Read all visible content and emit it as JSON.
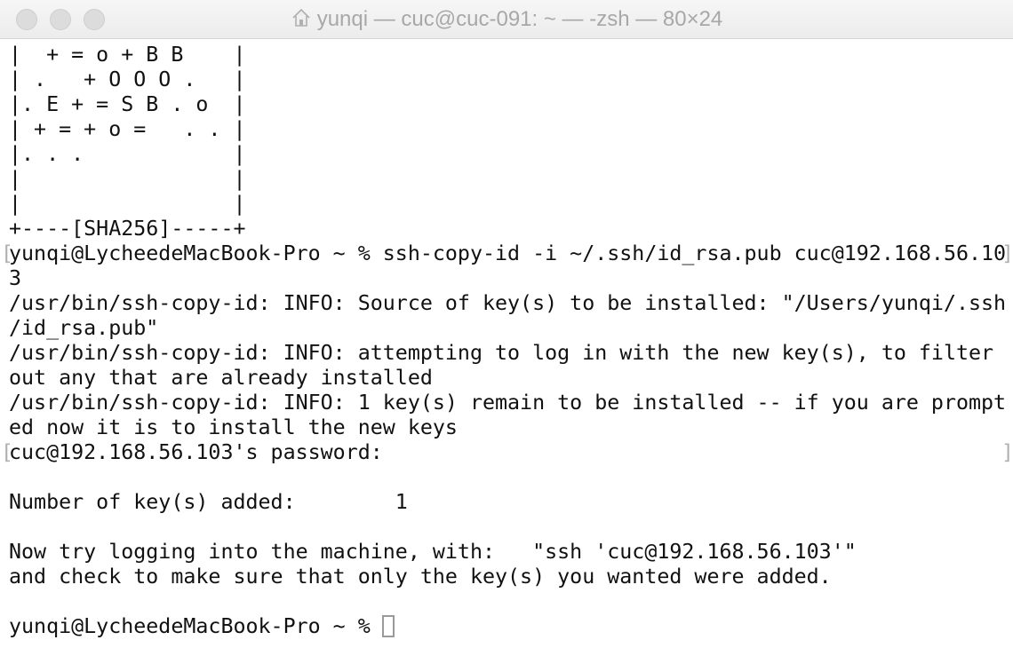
{
  "window": {
    "title": "yunqi — cuc@cuc-091: ~ — -zsh — 80×24",
    "title_icon": "home-icon"
  },
  "terminal": {
    "lines": [
      "|  + = o + B B    |",
      "| .   + O O O .   |",
      "|. E + = S B . o  |",
      "| + = + o =   . . |",
      "|. . .            |",
      "|                 |",
      "|                 |",
      "+----[SHA256]-----+",
      "yunqi@LycheedeMacBook-Pro ~ % ssh-copy-id -i ~/.ssh/id_rsa.pub cuc@192.168.56.10",
      "3",
      "/usr/bin/ssh-copy-id: INFO: Source of key(s) to be installed: \"/Users/yunqi/.ssh",
      "/id_rsa.pub\"",
      "/usr/bin/ssh-copy-id: INFO: attempting to log in with the new key(s), to filter",
      "out any that are already installed",
      "/usr/bin/ssh-copy-id: INFO: 1 key(s) remain to be installed -- if you are prompt",
      "ed now it is to install the new keys",
      "cuc@192.168.56.103's password:",
      "",
      "Number of key(s) added:        1",
      "",
      "Now try logging into the machine, with:   \"ssh 'cuc@192.168.56.103'\"",
      "and check to make sure that only the key(s) you wanted were added.",
      "",
      "yunqi@LycheedeMacBook-Pro ~ % "
    ],
    "marks": {
      "open": "[",
      "close": "]"
    }
  }
}
